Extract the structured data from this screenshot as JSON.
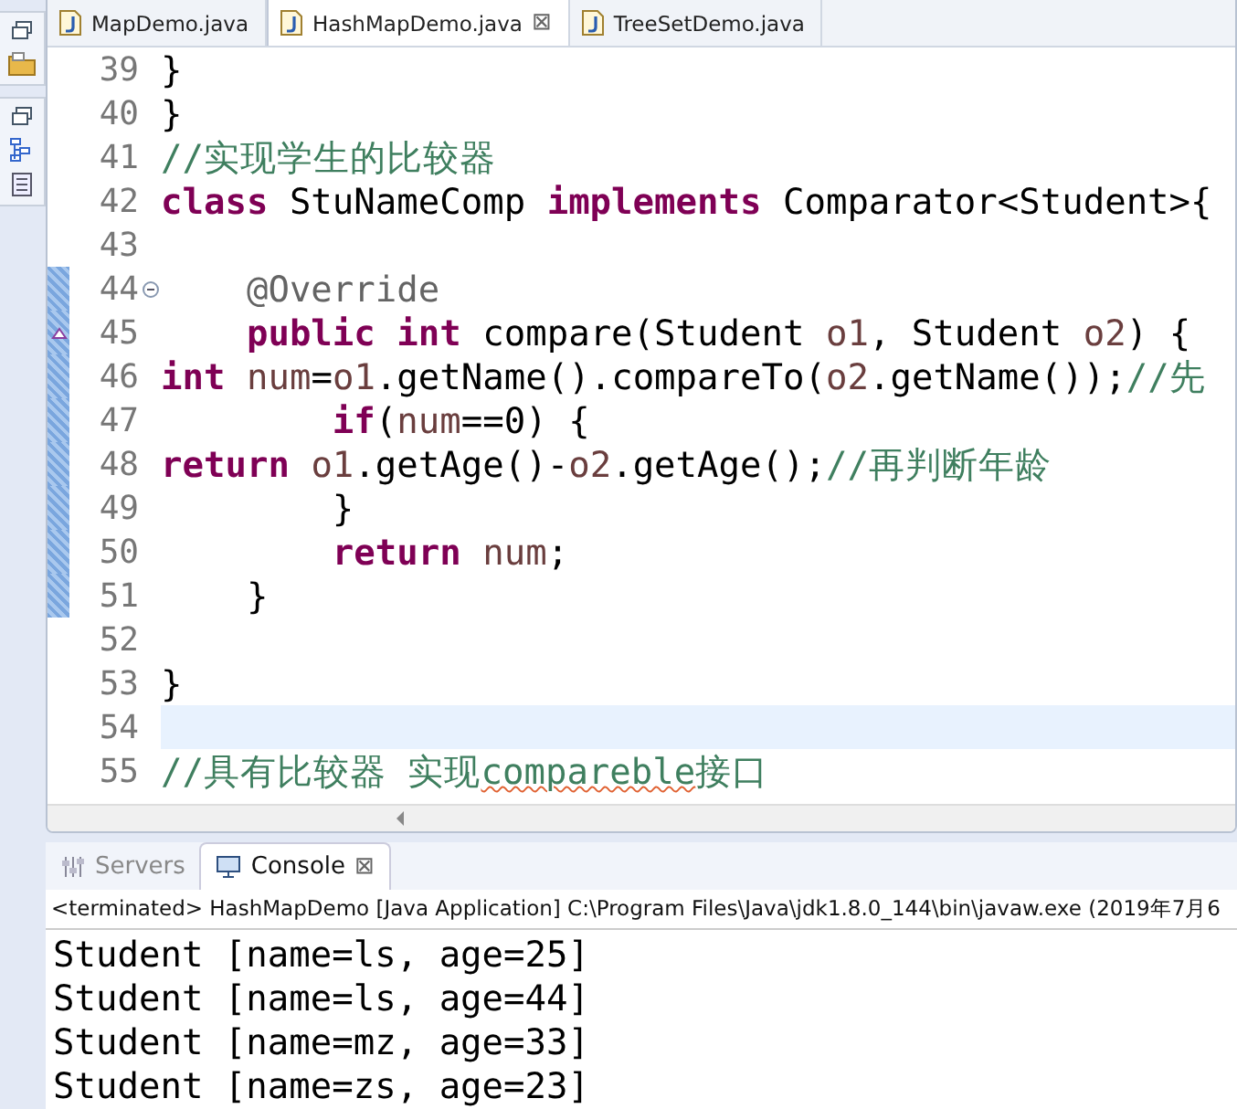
{
  "editor_tabs": [
    {
      "label": "MapDemo.java",
      "selected": false,
      "closable": false
    },
    {
      "label": "HashMapDemo.java",
      "selected": true,
      "closable": true
    },
    {
      "label": "TreeSetDemo.java",
      "selected": false,
      "closable": false
    }
  ],
  "close_glyph": "⊠",
  "code_lines": [
    {
      "number": "39",
      "tokens": [
        {
          "text": "}",
          "kind": "plain"
        }
      ]
    },
    {
      "number": "40",
      "tokens": [
        {
          "text": "}",
          "kind": "plain"
        }
      ]
    },
    {
      "number": "41",
      "tokens": [
        {
          "text": "//实现学生的比较器",
          "kind": "comment"
        }
      ]
    },
    {
      "number": "42",
      "tokens": [
        {
          "text": "class",
          "kind": "keyword"
        },
        {
          "text": " StuNameComp ",
          "kind": "plain"
        },
        {
          "text": "implements",
          "kind": "keyword"
        },
        {
          "text": " Comparator<Student>{",
          "kind": "plain"
        }
      ]
    },
    {
      "number": "43"
    },
    {
      "number": "44",
      "fold_open": true,
      "changed": true,
      "tokens": [
        {
          "text": "    @Override",
          "kind": "annotation"
        }
      ]
    },
    {
      "number": "45",
      "override_marker": true,
      "changed": true,
      "tokens": [
        {
          "text": "    public",
          "kind": "keyword"
        },
        {
          "text": " int",
          "kind": "keyword"
        },
        {
          "text": " compare(Student ",
          "kind": "plain"
        },
        {
          "text": "o1",
          "kind": "variable"
        },
        {
          "text": ", Student ",
          "kind": "plain"
        },
        {
          "text": "o2",
          "kind": "variable"
        },
        {
          "text": ") {",
          "kind": "plain"
        }
      ]
    },
    {
      "number": "46",
      "changed": true,
      "tokens": [
        {
          "text": "int",
          "kind": "keyword"
        },
        {
          "text": " num",
          "kind": "variable"
        },
        {
          "text": "=",
          "kind": "plain"
        },
        {
          "text": "o1",
          "kind": "variable"
        },
        {
          "text": ".getName().compareTo(",
          "kind": "plain"
        },
        {
          "text": "o2",
          "kind": "variable"
        },
        {
          "text": ".getName());",
          "kind": "plain"
        },
        {
          "text": "//先",
          "kind": "comment"
        }
      ]
    },
    {
      "number": "47",
      "changed": true,
      "tokens": [
        {
          "text": "        if",
          "kind": "keyword"
        },
        {
          "text": "(",
          "kind": "plain"
        },
        {
          "text": "num",
          "kind": "variable"
        },
        {
          "text": "==0) {",
          "kind": "plain"
        }
      ]
    },
    {
      "number": "48",
      "changed": true,
      "tokens": [
        {
          "text": "return",
          "kind": "keyword"
        },
        {
          "text": " o1",
          "kind": "variable"
        },
        {
          "text": ".getAge()-",
          "kind": "plain"
        },
        {
          "text": "o2",
          "kind": "variable"
        },
        {
          "text": ".getAge();",
          "kind": "plain"
        },
        {
          "text": "//再判断年龄",
          "kind": "comment"
        }
      ]
    },
    {
      "number": "49",
      "changed": true,
      "tokens": [
        {
          "text": "        }",
          "kind": "plain"
        }
      ]
    },
    {
      "number": "50",
      "changed": true,
      "tokens": [
        {
          "text": "        return",
          "kind": "keyword"
        },
        {
          "text": " num",
          "kind": "variable"
        },
        {
          "text": ";",
          "kind": "plain"
        }
      ]
    },
    {
      "number": "51",
      "changed": true,
      "tokens": [
        {
          "text": "    }",
          "kind": "plain"
        }
      ]
    },
    {
      "number": "52"
    },
    {
      "number": "53",
      "tokens": [
        {
          "text": "}",
          "kind": "plain"
        }
      ]
    },
    {
      "number": "54",
      "current": true
    },
    {
      "number": "55",
      "tokens": [
        {
          "text": "//具有比较器 实现",
          "kind": "comment"
        },
        {
          "text": "compareble",
          "kind": "comment",
          "spell_error": true
        },
        {
          "text": "接口",
          "kind": "comment"
        }
      ]
    }
  ],
  "console_tabs": [
    {
      "label": "Servers",
      "selected": false,
      "closable": false
    },
    {
      "label": "Console",
      "selected": true,
      "closable": true
    }
  ],
  "console_header": "<terminated> HashMapDemo [Java Application] C:\\Program Files\\Java\\jdk1.8.0_144\\bin\\javaw.exe (2019年7月6",
  "console_output": [
    "Student [name=ls, age=25]",
    "Student [name=ls, age=44]",
    "Student [name=mz, age=33]",
    "Student [name=zs, age=23]"
  ]
}
